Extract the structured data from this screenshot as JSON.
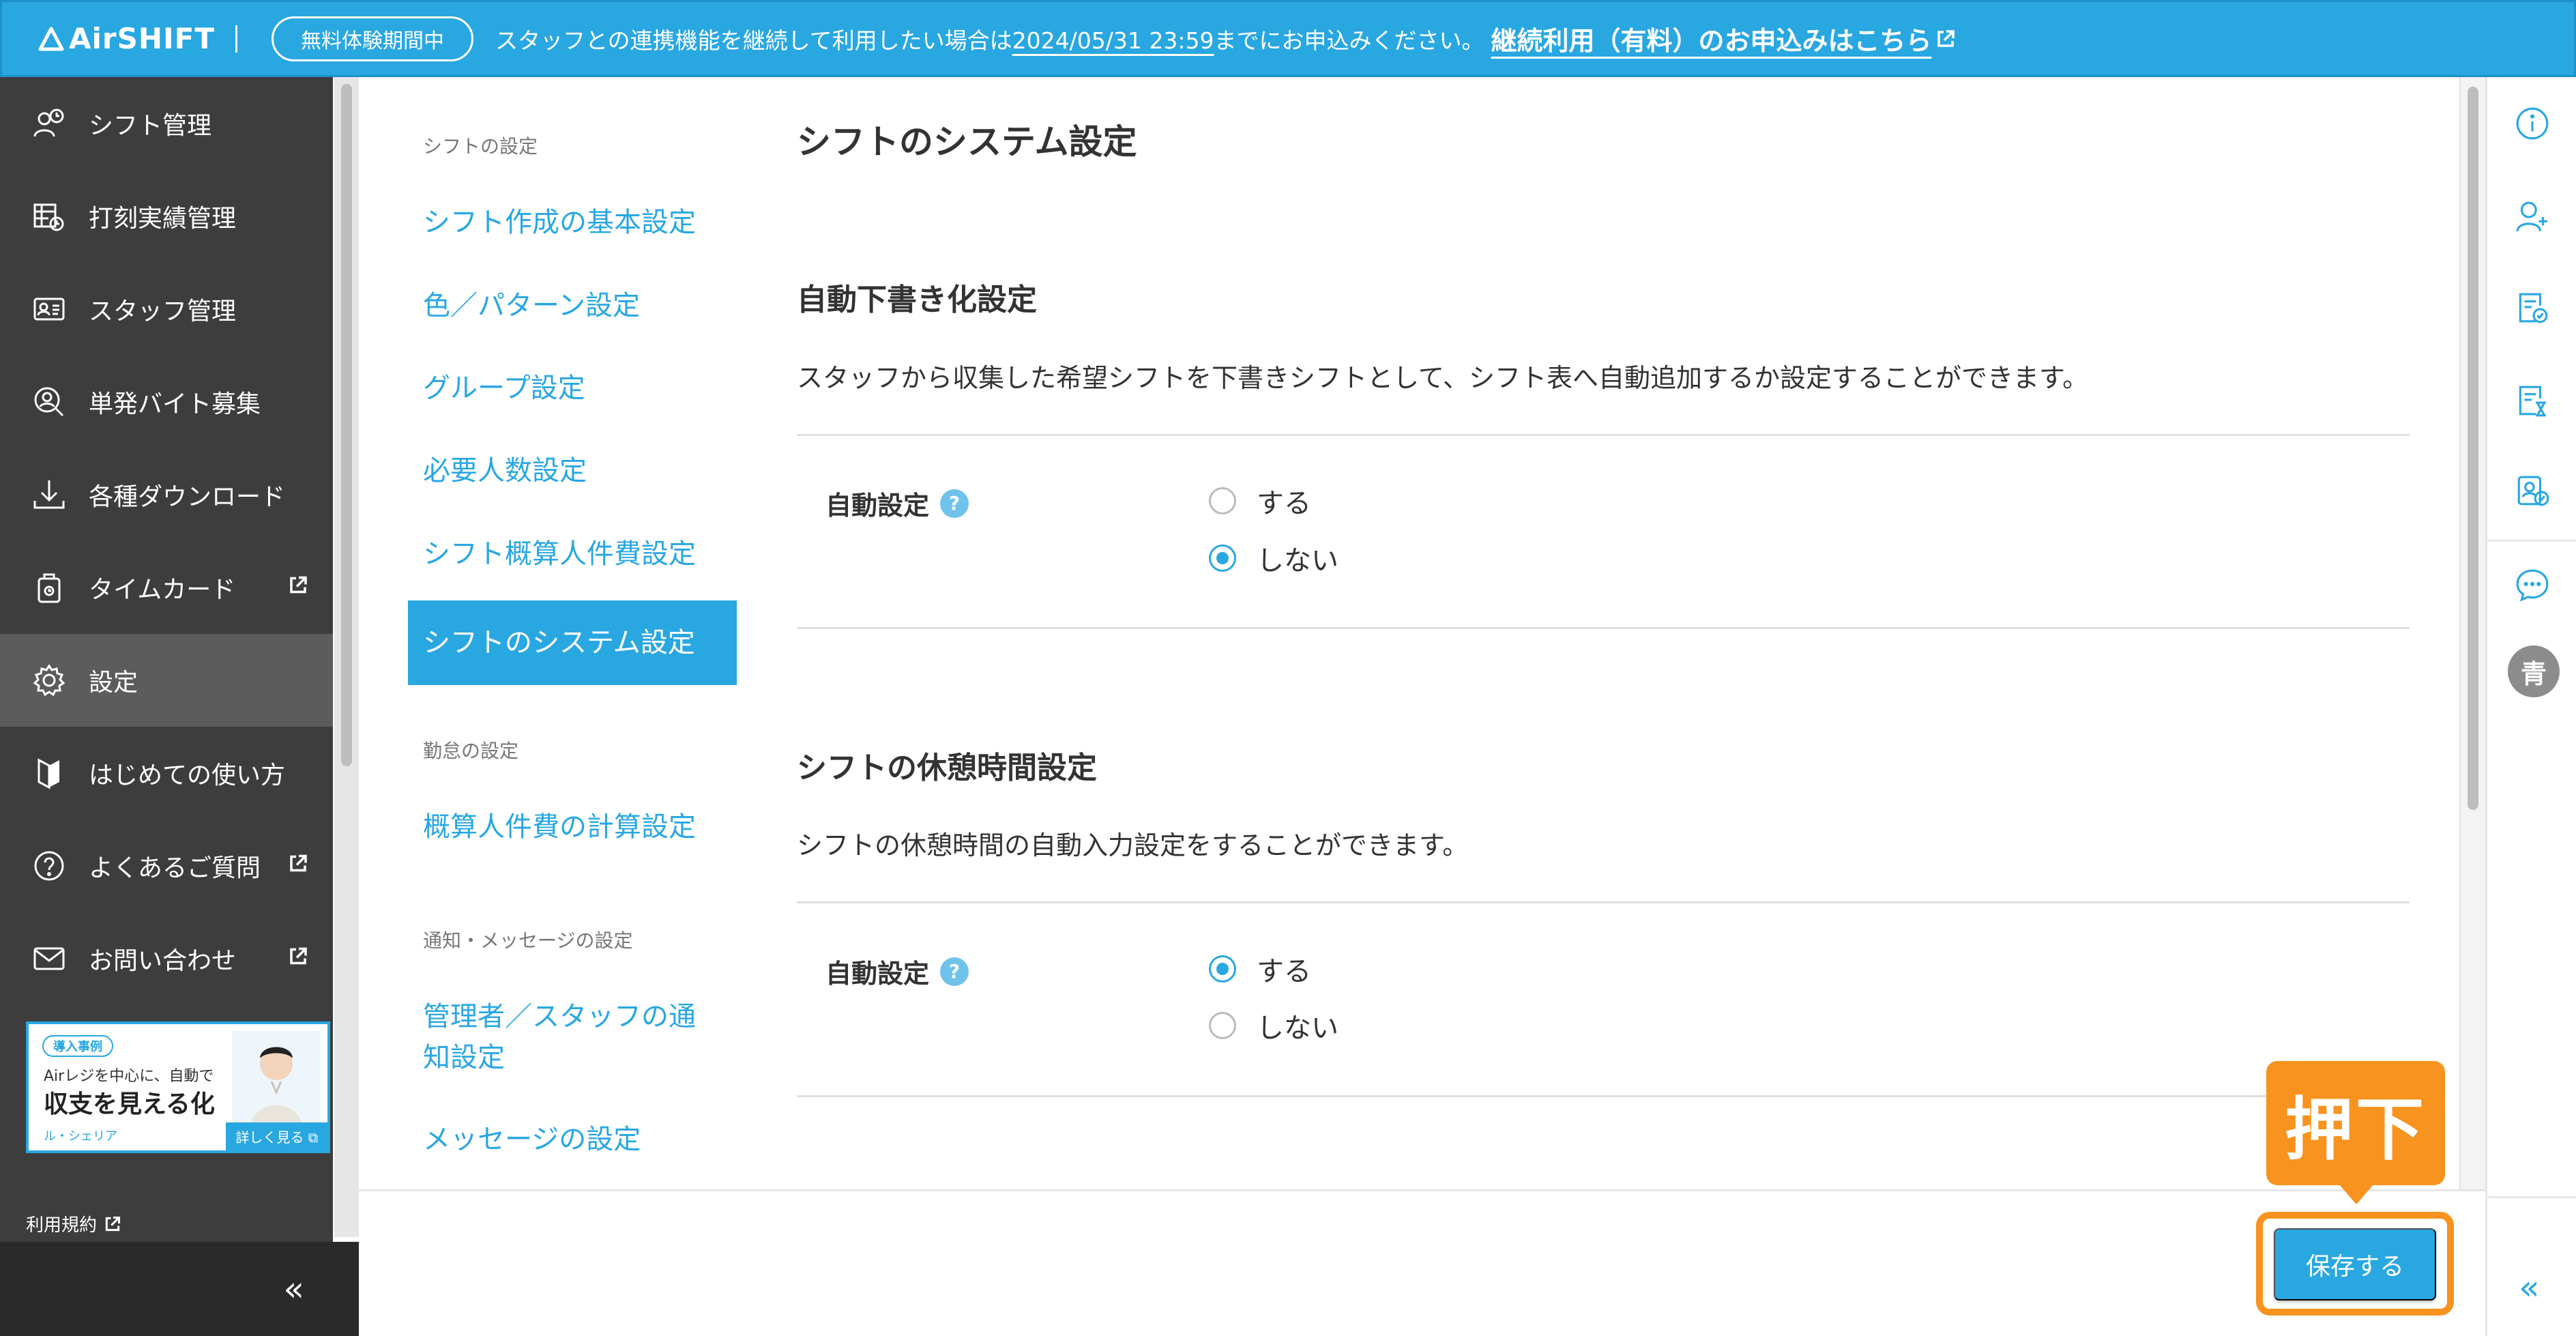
{
  "banner": {
    "logo": "AirSHIFT",
    "trial_badge": "無料体験期間中",
    "notice_prefix": "スタッフとの連携機能を継続して利用したい場合は",
    "notice_date": "2024/05/31 23:59",
    "notice_suffix": "までにお申込みください。",
    "notice_link": "継続利用（有料）のお申込みはこちら"
  },
  "sidebar": {
    "items": [
      {
        "label": "シフト管理",
        "icon": "shift-icon"
      },
      {
        "label": "打刻実績管理",
        "icon": "timesheet-icon"
      },
      {
        "label": "スタッフ管理",
        "icon": "staff-card-icon"
      },
      {
        "label": "単発バイト募集",
        "icon": "search-person-icon"
      },
      {
        "label": "各種ダウンロード",
        "icon": "download-icon"
      },
      {
        "label": "タイムカード",
        "icon": "timecard-icon",
        "external": true
      },
      {
        "label": "設定",
        "icon": "gear-icon",
        "active": true
      },
      {
        "label": "はじめての使い方",
        "icon": "beginner-icon"
      },
      {
        "label": "よくあるご質問",
        "icon": "question-icon",
        "external": true
      },
      {
        "label": "お問い合わせ",
        "icon": "mail-icon",
        "external": true
      }
    ],
    "promo": {
      "tag": "導入事例",
      "line1": "Airレジを中心に、自動で",
      "line2": "収支を見える化",
      "brand": "ル・シェリア",
      "more": "詳しく見る"
    },
    "terms": "利用規約",
    "collapse": "«"
  },
  "subnav": {
    "section1": "シフトの設定",
    "links1": [
      "シフト作成の基本設定",
      "色／パターン設定",
      "グループ設定",
      "必要人数設定",
      "シフト概算人件費設定"
    ],
    "active": "シフトのシステム設定",
    "section2": "勤怠の設定",
    "links2": [
      "概算人件費の計算設定"
    ],
    "section3": "通知・メッセージの設定",
    "links3_line1": "管理者／スタッフの通",
    "links3_line2": "知設定",
    "links3b": "メッセージの設定"
  },
  "content": {
    "title": "シフトのシステム設定",
    "section1": {
      "heading": "自動下書き化設定",
      "description": "スタッフから収集した希望シフトを下書きシフトとして、シフト表へ自動追加するか設定することができます。",
      "label": "自動設定",
      "options": [
        "する",
        "しない"
      ],
      "selected": "しない"
    },
    "section2": {
      "heading": "シフトの休憩時間設定",
      "description": "シフトの休憩時間の自動入力設定をすることができます。",
      "label": "自動設定",
      "options": [
        "する",
        "しない"
      ],
      "selected": "する"
    }
  },
  "footer": {
    "save_label": "保存する",
    "callout": "押下"
  },
  "rail": {
    "avatar": "青",
    "collapse": "«"
  },
  "colors": {
    "brand": "#29a7e1",
    "sidebar": "#3d3d3d",
    "callout": "#f7931e"
  }
}
